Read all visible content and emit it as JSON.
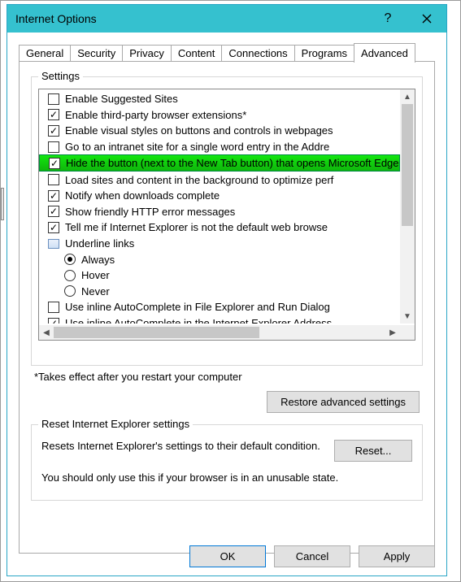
{
  "window": {
    "title": "Internet Options"
  },
  "tabs": {
    "general": "General",
    "security": "Security",
    "privacy": "Privacy",
    "content": "Content",
    "connections": "Connections",
    "programs": "Programs",
    "advanced": "Advanced"
  },
  "settings": {
    "group_label": "Settings",
    "items": {
      "enable_suggested": "Enable Suggested Sites",
      "enable_third_party": "Enable third-party browser extensions*",
      "enable_visual": "Enable visual styles on buttons and controls in webpages",
      "go_intranet": "Go to an intranet site for a single word entry in the Addre",
      "hide_button": "Hide the button (next to the New Tab button) that opens Microsoft Edge",
      "load_bg": "Load sites and content in the background to optimize perf",
      "notify_dl": "Notify when downloads complete",
      "show_http": "Show friendly HTTP error messages",
      "tell_me": "Tell me if Internet Explorer is not the default web browse",
      "underline_header": "Underline links",
      "always": "Always",
      "hover": "Hover",
      "never": "Never",
      "use_inline_fe": "Use inline AutoComplete in File Explorer and Run Dialog",
      "use_inline_ie": "Use inline AutoComplete in the Internet Explorer Address"
    },
    "note": "*Takes effect after you restart your computer",
    "restore_btn": "Restore advanced settings"
  },
  "reset": {
    "group_label": "Reset Internet Explorer settings",
    "desc": "Resets Internet Explorer's settings to their default condition.",
    "btn": "Reset...",
    "warn": "You should only use this if your browser is in an unusable state."
  },
  "buttons": {
    "ok": "OK",
    "cancel": "Cancel",
    "apply": "Apply"
  }
}
